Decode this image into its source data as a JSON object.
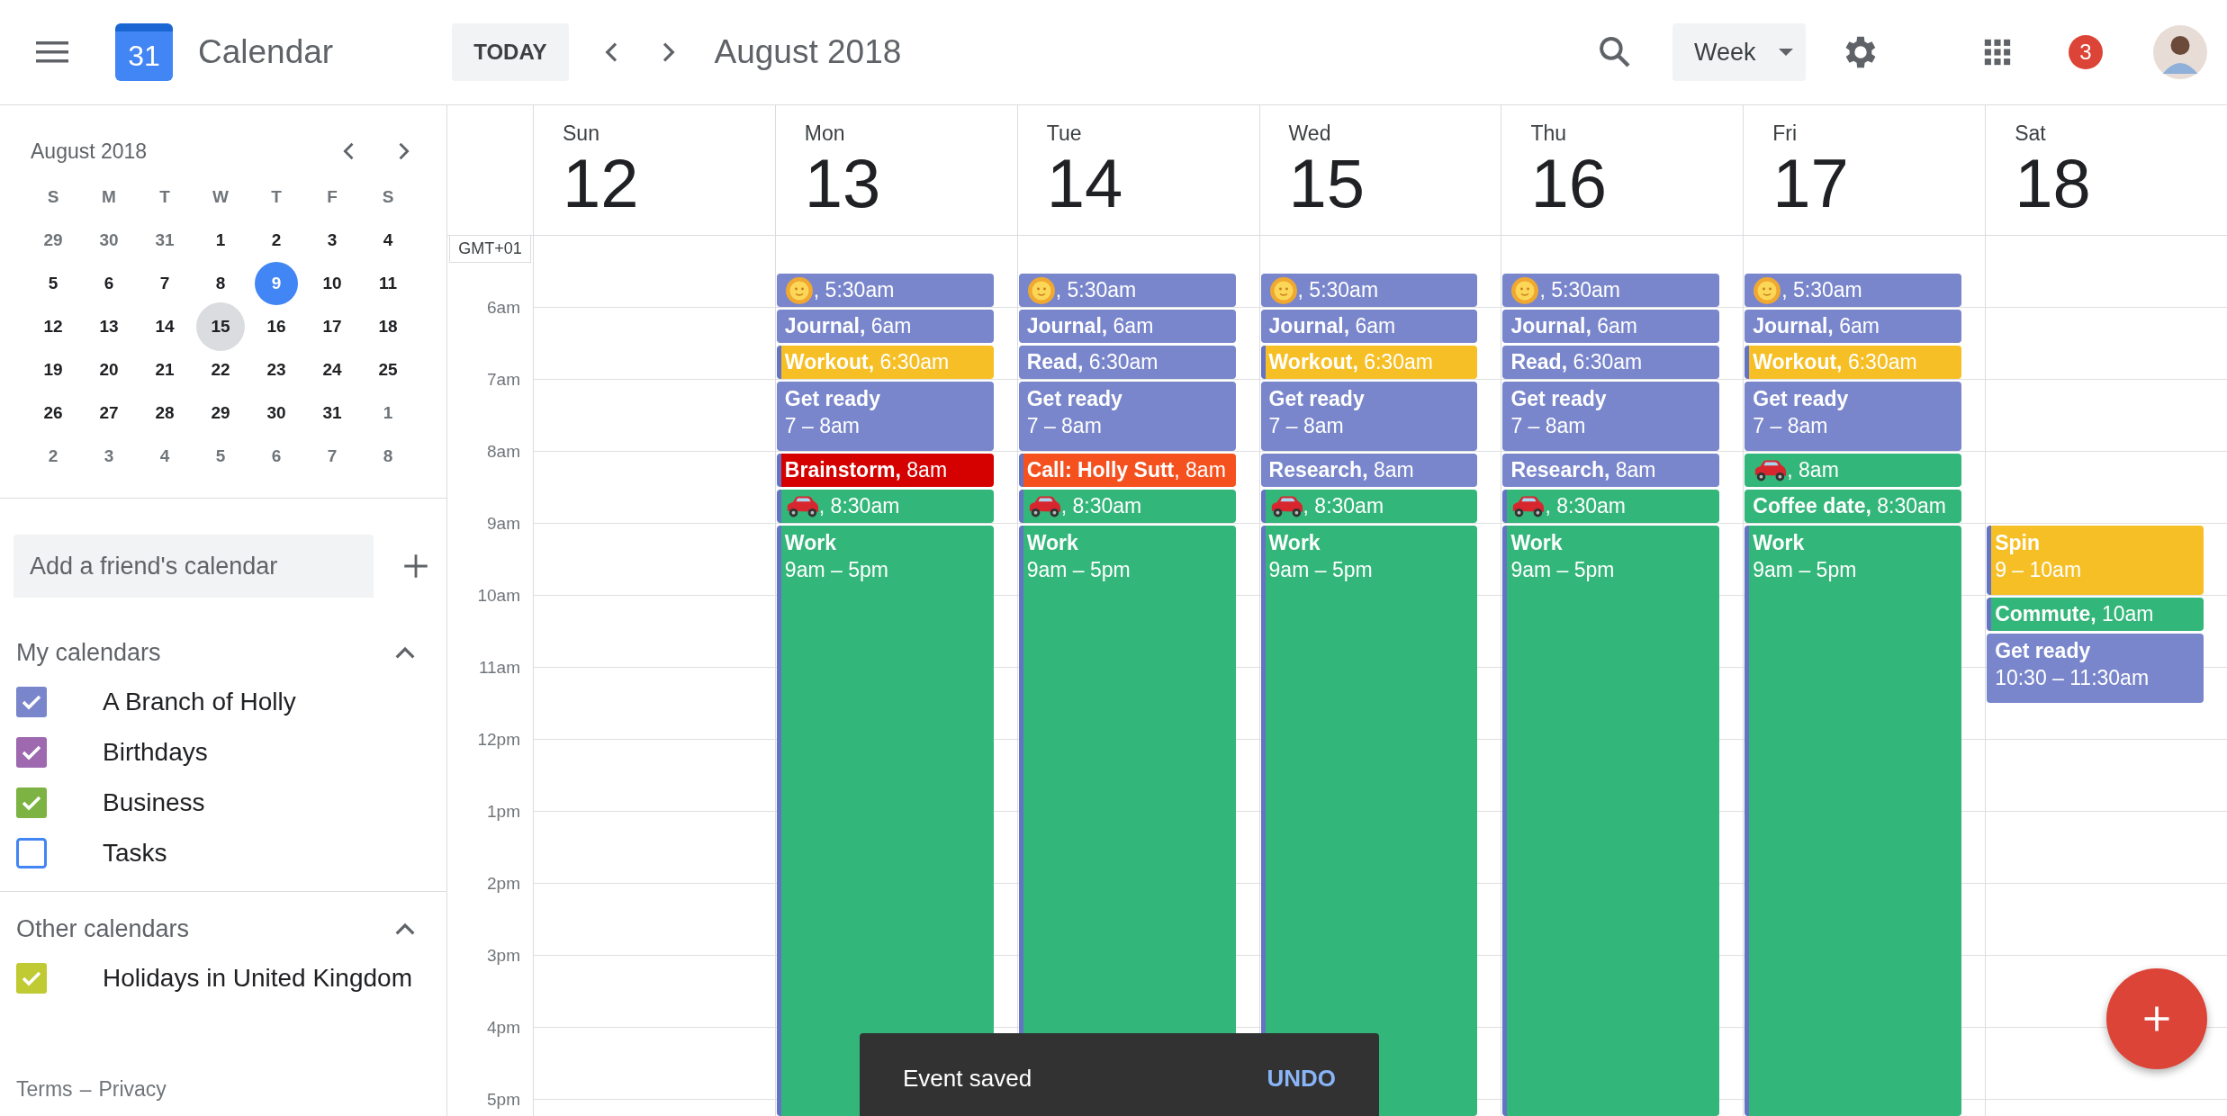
{
  "header": {
    "app_name": "Calendar",
    "logo_day": "31",
    "today_button": "TODAY",
    "period": "August 2018",
    "view": "Week",
    "notifications": "3"
  },
  "mini_calendar": {
    "title": "August 2018",
    "weekdays": [
      "S",
      "M",
      "T",
      "W",
      "T",
      "F",
      "S"
    ],
    "weeks": [
      [
        {
          "label": "29",
          "in_month": false,
          "today": false,
          "selected": false
        },
        {
          "label": "30",
          "in_month": false,
          "today": false,
          "selected": false
        },
        {
          "label": "31",
          "in_month": false,
          "today": false,
          "selected": false
        },
        {
          "label": "1",
          "in_month": true,
          "today": false,
          "selected": false
        },
        {
          "label": "2",
          "in_month": true,
          "today": false,
          "selected": false
        },
        {
          "label": "3",
          "in_month": true,
          "today": false,
          "selected": false
        },
        {
          "label": "4",
          "in_month": true,
          "today": false,
          "selected": false
        }
      ],
      [
        {
          "label": "5",
          "in_month": true,
          "today": false,
          "selected": false
        },
        {
          "label": "6",
          "in_month": true,
          "today": false,
          "selected": false
        },
        {
          "label": "7",
          "in_month": true,
          "today": false,
          "selected": false
        },
        {
          "label": "8",
          "in_month": true,
          "today": false,
          "selected": false
        },
        {
          "label": "9",
          "in_month": true,
          "today": true,
          "selected": false
        },
        {
          "label": "10",
          "in_month": true,
          "today": false,
          "selected": false
        },
        {
          "label": "11",
          "in_month": true,
          "today": false,
          "selected": false
        }
      ],
      [
        {
          "label": "12",
          "in_month": true,
          "today": false,
          "selected": false
        },
        {
          "label": "13",
          "in_month": true,
          "today": false,
          "selected": false
        },
        {
          "label": "14",
          "in_month": true,
          "today": false,
          "selected": false
        },
        {
          "label": "15",
          "in_month": true,
          "today": false,
          "selected": true
        },
        {
          "label": "16",
          "in_month": true,
          "today": false,
          "selected": false
        },
        {
          "label": "17",
          "in_month": true,
          "today": false,
          "selected": false
        },
        {
          "label": "18",
          "in_month": true,
          "today": false,
          "selected": false
        }
      ],
      [
        {
          "label": "19",
          "in_month": true,
          "today": false,
          "selected": false
        },
        {
          "label": "20",
          "in_month": true,
          "today": false,
          "selected": false
        },
        {
          "label": "21",
          "in_month": true,
          "today": false,
          "selected": false
        },
        {
          "label": "22",
          "in_month": true,
          "today": false,
          "selected": false
        },
        {
          "label": "23",
          "in_month": true,
          "today": false,
          "selected": false
        },
        {
          "label": "24",
          "in_month": true,
          "today": false,
          "selected": false
        },
        {
          "label": "25",
          "in_month": true,
          "today": false,
          "selected": false
        }
      ],
      [
        {
          "label": "26",
          "in_month": true,
          "today": false,
          "selected": false
        },
        {
          "label": "27",
          "in_month": true,
          "today": false,
          "selected": false
        },
        {
          "label": "28",
          "in_month": true,
          "today": false,
          "selected": false
        },
        {
          "label": "29",
          "in_month": true,
          "today": false,
          "selected": false
        },
        {
          "label": "30",
          "in_month": true,
          "today": false,
          "selected": false
        },
        {
          "label": "31",
          "in_month": true,
          "today": false,
          "selected": false
        },
        {
          "label": "1",
          "in_month": false,
          "today": false,
          "selected": false
        }
      ],
      [
        {
          "label": "2",
          "in_month": false,
          "today": false,
          "selected": false
        },
        {
          "label": "3",
          "in_month": false,
          "today": false,
          "selected": false
        },
        {
          "label": "4",
          "in_month": false,
          "today": false,
          "selected": false
        },
        {
          "label": "5",
          "in_month": false,
          "today": false,
          "selected": false
        },
        {
          "label": "6",
          "in_month": false,
          "today": false,
          "selected": false
        },
        {
          "label": "7",
          "in_month": false,
          "today": false,
          "selected": false
        },
        {
          "label": "8",
          "in_month": false,
          "today": false,
          "selected": false
        }
      ]
    ]
  },
  "add_calendar": {
    "placeholder": "Add a friend's calendar"
  },
  "my_calendars": {
    "title": "My calendars",
    "expanded": true,
    "items": [
      {
        "label": "A Branch of Holly",
        "checked": true,
        "color": "#7986cb"
      },
      {
        "label": "Birthdays",
        "checked": true,
        "color": "#9e69af"
      },
      {
        "label": "Business",
        "checked": true,
        "color": "#7cb342"
      },
      {
        "label": "Tasks",
        "checked": false,
        "color": "#4285f4"
      }
    ]
  },
  "other_calendars": {
    "title": "Other calendars",
    "expanded": true,
    "items": [
      {
        "label": "Holidays in United Kingdom",
        "checked": true,
        "color": "#c0ca33"
      }
    ]
  },
  "footer_links": {
    "terms": "Terms",
    "separator": "–",
    "privacy": "Privacy"
  },
  "timezone": "GMT+01",
  "hours": [
    "6am",
    "7am",
    "8am",
    "9am",
    "10am",
    "11am",
    "12pm",
    "1pm",
    "2pm",
    "3pm",
    "4pm",
    "5pm"
  ],
  "days": [
    {
      "name": "Sun",
      "date": "12"
    },
    {
      "name": "Mon",
      "date": "13",
      "events": [
        {
          "kind": "sun",
          "text": ", 5:30am",
          "color": "#7986cb",
          "stripe": false
        },
        {
          "kind": "line",
          "text": "**Journal,** 6am",
          "color": "#7986cb",
          "stripe": false
        },
        {
          "kind": "line",
          "text": "**Workout,** 6:30am",
          "color": "#f6bf26",
          "stripe": true
        },
        {
          "kind": "block",
          "title": "Get ready",
          "time": "7 – 8am",
          "color": "#7986cb",
          "stripe": false
        },
        {
          "kind": "line",
          "text": "**Brainstorm,** 8am",
          "color": "#d50000",
          "stripe": true
        },
        {
          "kind": "car",
          "text": ", 8:30am",
          "color": "#33b679",
          "stripe": true
        },
        {
          "kind": "long",
          "title": "Work",
          "time": "9am – 5pm",
          "color": "#33b679",
          "stripe": true
        }
      ]
    },
    {
      "name": "Tue",
      "date": "14",
      "events": [
        {
          "kind": "sun",
          "text": ", 5:30am",
          "color": "#7986cb",
          "stripe": false
        },
        {
          "kind": "line",
          "text": "**Journal,** 6am",
          "color": "#7986cb",
          "stripe": false
        },
        {
          "kind": "line",
          "text": "**Read,** 6:30am",
          "color": "#7986cb",
          "stripe": false
        },
        {
          "kind": "block",
          "title": "Get ready",
          "time": "7 – 8am",
          "color": "#7986cb",
          "stripe": false
        },
        {
          "kind": "line",
          "text": "**Call: Holly Sutt**, 8am",
          "color": "#f4511e",
          "stripe": true
        },
        {
          "kind": "car",
          "text": ", 8:30am",
          "color": "#33b679",
          "stripe": true
        },
        {
          "kind": "long",
          "title": "Work",
          "time": "9am – 5pm",
          "color": "#33b679",
          "stripe": true
        }
      ]
    },
    {
      "name": "Wed",
      "date": "15",
      "events": [
        {
          "kind": "sun",
          "text": ", 5:30am",
          "color": "#7986cb",
          "stripe": false
        },
        {
          "kind": "line",
          "text": "**Journal,** 6am",
          "color": "#7986cb",
          "stripe": false
        },
        {
          "kind": "line",
          "text": "**Workout,** 6:30am",
          "color": "#f6bf26",
          "stripe": true
        },
        {
          "kind": "block",
          "title": "Get ready",
          "time": "7 – 8am",
          "color": "#7986cb",
          "stripe": false
        },
        {
          "kind": "line",
          "text": "**Research,** 8am",
          "color": "#7986cb",
          "stripe": false
        },
        {
          "kind": "car",
          "text": ", 8:30am",
          "color": "#33b679",
          "stripe": true
        },
        {
          "kind": "long",
          "title": "Work",
          "time": "9am – 5pm",
          "color": "#33b679",
          "stripe": true
        }
      ]
    },
    {
      "name": "Thu",
      "date": "16",
      "events": [
        {
          "kind": "sun",
          "text": ", 5:30am",
          "color": "#7986cb",
          "stripe": false
        },
        {
          "kind": "line",
          "text": "**Journal,** 6am",
          "color": "#7986cb",
          "stripe": false
        },
        {
          "kind": "line",
          "text": "**Read,** 6:30am",
          "color": "#7986cb",
          "stripe": false
        },
        {
          "kind": "block",
          "title": "Get ready",
          "time": "7 – 8am",
          "color": "#7986cb",
          "stripe": false
        },
        {
          "kind": "line",
          "text": "**Research,** 8am",
          "color": "#7986cb",
          "stripe": false
        },
        {
          "kind": "car",
          "text": ", 8:30am",
          "color": "#33b679",
          "stripe": true
        },
        {
          "kind": "long",
          "title": "Work",
          "time": "9am – 5pm",
          "color": "#33b679",
          "stripe": true
        }
      ]
    },
    {
      "name": "Fri",
      "date": "17",
      "events": [
        {
          "kind": "sun",
          "text": ", 5:30am",
          "color": "#7986cb",
          "stripe": false
        },
        {
          "kind": "line",
          "text": "**Journal,** 6am",
          "color": "#7986cb",
          "stripe": false
        },
        {
          "kind": "line",
          "text": "**Workout,** 6:30am",
          "color": "#f6bf26",
          "stripe": true
        },
        {
          "kind": "block",
          "title": "Get ready",
          "time": "7 – 8am",
          "color": "#7986cb",
          "stripe": false
        },
        {
          "kind": "car",
          "text": ", 8am",
          "color": "#33b679",
          "stripe": false
        },
        {
          "kind": "line",
          "text": "**Coffee date,** 8:30am",
          "color": "#33b679",
          "stripe": false
        },
        {
          "kind": "long",
          "title": "Work",
          "time": "9am – 5pm",
          "color": "#33b679",
          "stripe": true
        }
      ]
    },
    {
      "name": "Sat",
      "date": "18",
      "events": [
        {
          "kind": "free"
        },
        {
          "kind": "free"
        },
        {
          "kind": "free"
        },
        {
          "kind": "free"
        },
        {
          "kind": "free"
        },
        {
          "kind": "free"
        },
        {
          "kind": "free"
        },
        {
          "kind": "block",
          "title": "Spin",
          "time": "9 – 10am",
          "color": "#f6bf26",
          "stripe": true
        },
        {
          "kind": "line",
          "text": "**Commute,** 10am",
          "color": "#33b679",
          "stripe": true
        },
        {
          "kind": "block",
          "title": "Get ready",
          "time": "10:30 – 11:30am",
          "color": "#7986cb",
          "stripe": false
        }
      ]
    }
  ],
  "toast": {
    "message": "Event saved",
    "action": "UNDO"
  }
}
